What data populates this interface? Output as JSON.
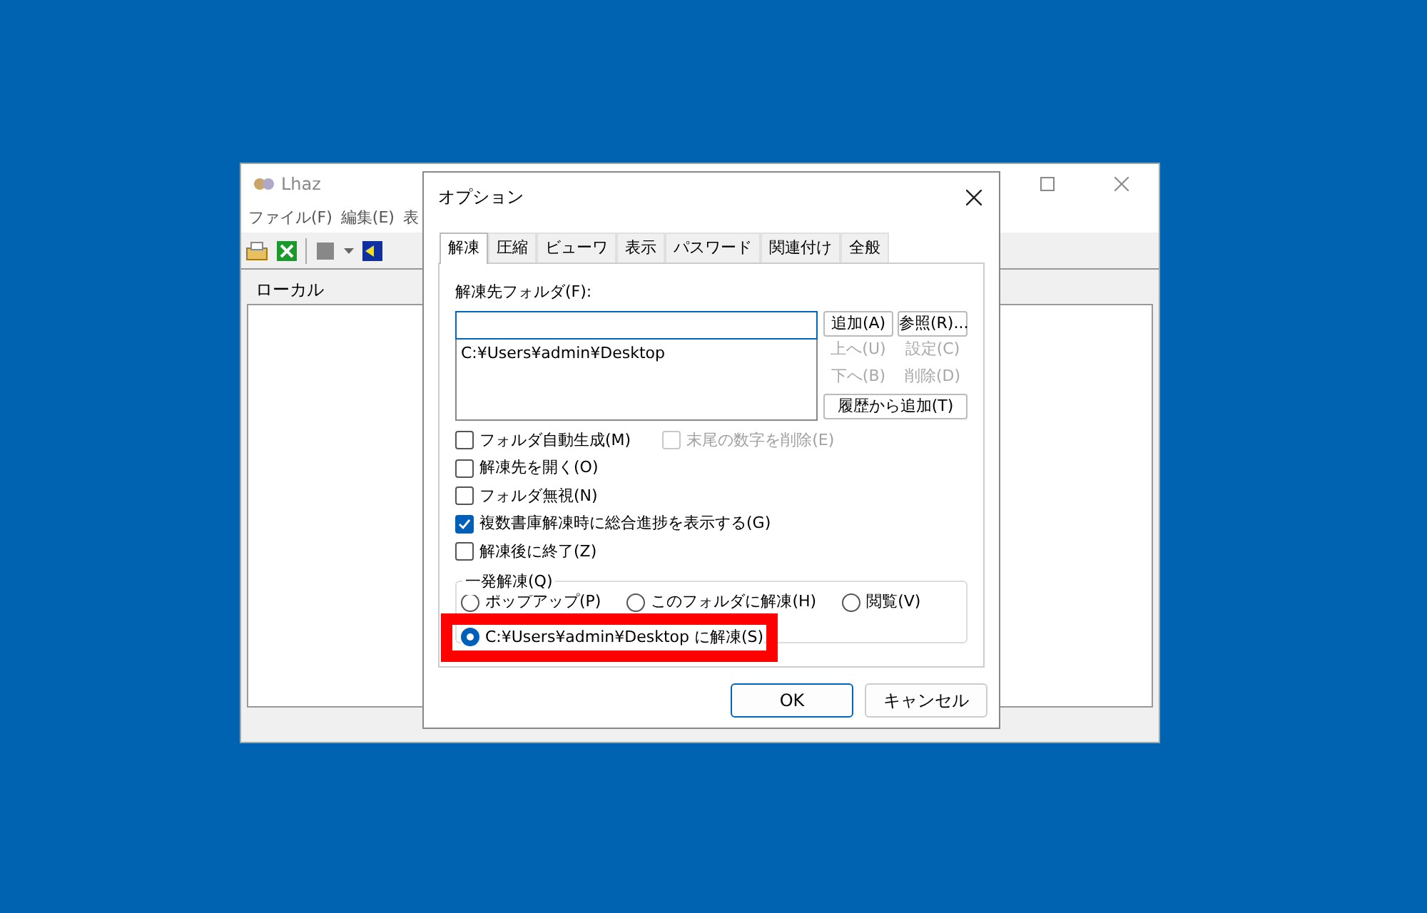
{
  "main_window": {
    "title": "Lhaz",
    "menu": [
      "ファイル(F)",
      "編集(E)",
      "表"
    ],
    "pane": {
      "header": "ローカル"
    }
  },
  "dialog": {
    "title": "オプション",
    "tabs": [
      {
        "label": "解凍",
        "selected": true
      },
      {
        "label": "圧縮",
        "selected": false
      },
      {
        "label": "ビューワ",
        "selected": false
      },
      {
        "label": "表示",
        "selected": false
      },
      {
        "label": "パスワード",
        "selected": false
      },
      {
        "label": "関連付け",
        "selected": false
      },
      {
        "label": "全般",
        "selected": false
      }
    ],
    "folder_label": "解凍先フォルダ(F):",
    "folder_list": [
      "C:¥Users¥admin¥Desktop"
    ],
    "side_buttons": [
      {
        "label": "追加(A)",
        "disabled": false
      },
      {
        "label": "参照(R)...",
        "disabled": false
      },
      {
        "label": "上へ(U)",
        "disabled": true
      },
      {
        "label": "設定(C)",
        "disabled": true
      },
      {
        "label": "下へ(B)",
        "disabled": true
      },
      {
        "label": "削除(D)",
        "disabled": true
      }
    ],
    "history_button": "履歴から追加(T)",
    "checkboxes": [
      {
        "label": "フォルダ自動生成(M)",
        "checked": false,
        "disabled": false
      },
      {
        "label": "末尾の数字を削除(E)",
        "checked": false,
        "disabled": true
      },
      {
        "label": "解凍先を開く(O)",
        "checked": false,
        "disabled": false
      },
      {
        "label": "フォルダ無視(N)",
        "checked": false,
        "disabled": false
      },
      {
        "label": "複数書庫解凍時に総合進捗を表示する(G)",
        "checked": true,
        "disabled": false
      },
      {
        "label": "解凍後に終了(Z)",
        "checked": false,
        "disabled": false
      }
    ],
    "quick_group": {
      "title": "一発解凍(Q)",
      "options": [
        {
          "label": "ポップアップ(P)",
          "selected": false
        },
        {
          "label": "このフォルダに解凍(H)",
          "selected": false
        },
        {
          "label": "閲覧(V)",
          "selected": false
        },
        {
          "label": "C:¥Users¥admin¥Desktop に解凍(S)",
          "selected": true,
          "highlighted": true
        }
      ]
    },
    "buttons": [
      {
        "label": "OK",
        "default": true
      },
      {
        "label": "キャンセル",
        "default": false
      }
    ]
  }
}
